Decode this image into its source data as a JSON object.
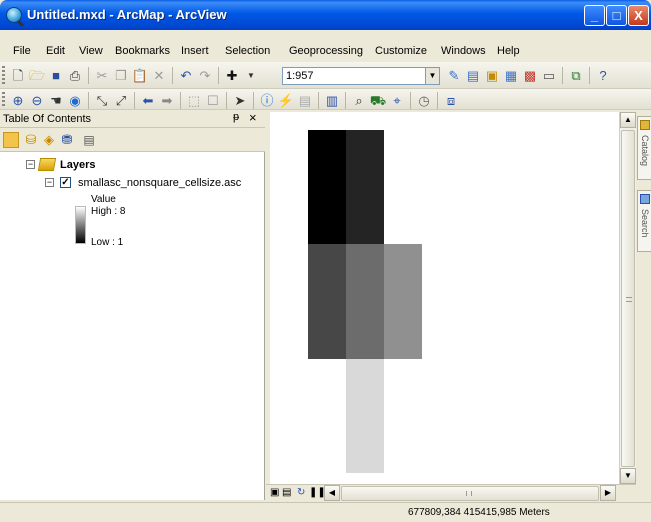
{
  "window": {
    "title": "Untitled.mxd - ArcMap - ArcView",
    "minimize_label": "_",
    "maximize_label": "□",
    "close_label": "X"
  },
  "menu": {
    "items": [
      "File",
      "Edit",
      "View",
      "Bookmarks",
      "Insert",
      "Selection",
      "Geoprocessing",
      "Customize",
      "Windows",
      "Help"
    ]
  },
  "toolbar": {
    "scale_value": "1:957"
  },
  "toc": {
    "title": "Table Of Contents",
    "pin_label": "ᵽ",
    "close_label": "×",
    "layers_label": "Layers",
    "layer_name": "smallasc_nonsquare_cellsize.asc",
    "legend_field": "Value",
    "legend_high": "High : 8",
    "legend_low": "Low : 1"
  },
  "map": {
    "raster_cells": [
      {
        "row": 0,
        "col": 0,
        "color": "#000000"
      },
      {
        "row": 0,
        "col": 1,
        "color": "#242424"
      },
      {
        "row": 1,
        "col": 0,
        "color": "#474747"
      },
      {
        "row": 1,
        "col": 1,
        "color": "#6c6c6c"
      },
      {
        "row": 1,
        "col": 2,
        "color": "#909090"
      },
      {
        "row": 2,
        "col": 1,
        "color": "#d9d9d9"
      },
      {
        "row": 2,
        "col": 2,
        "color": "#ffffff"
      }
    ]
  },
  "sidedock": {
    "catalog_label": "Catalog",
    "search_label": "Search"
  },
  "statusbar": {
    "coordinates": "677809,384  415415,985 Meters"
  }
}
